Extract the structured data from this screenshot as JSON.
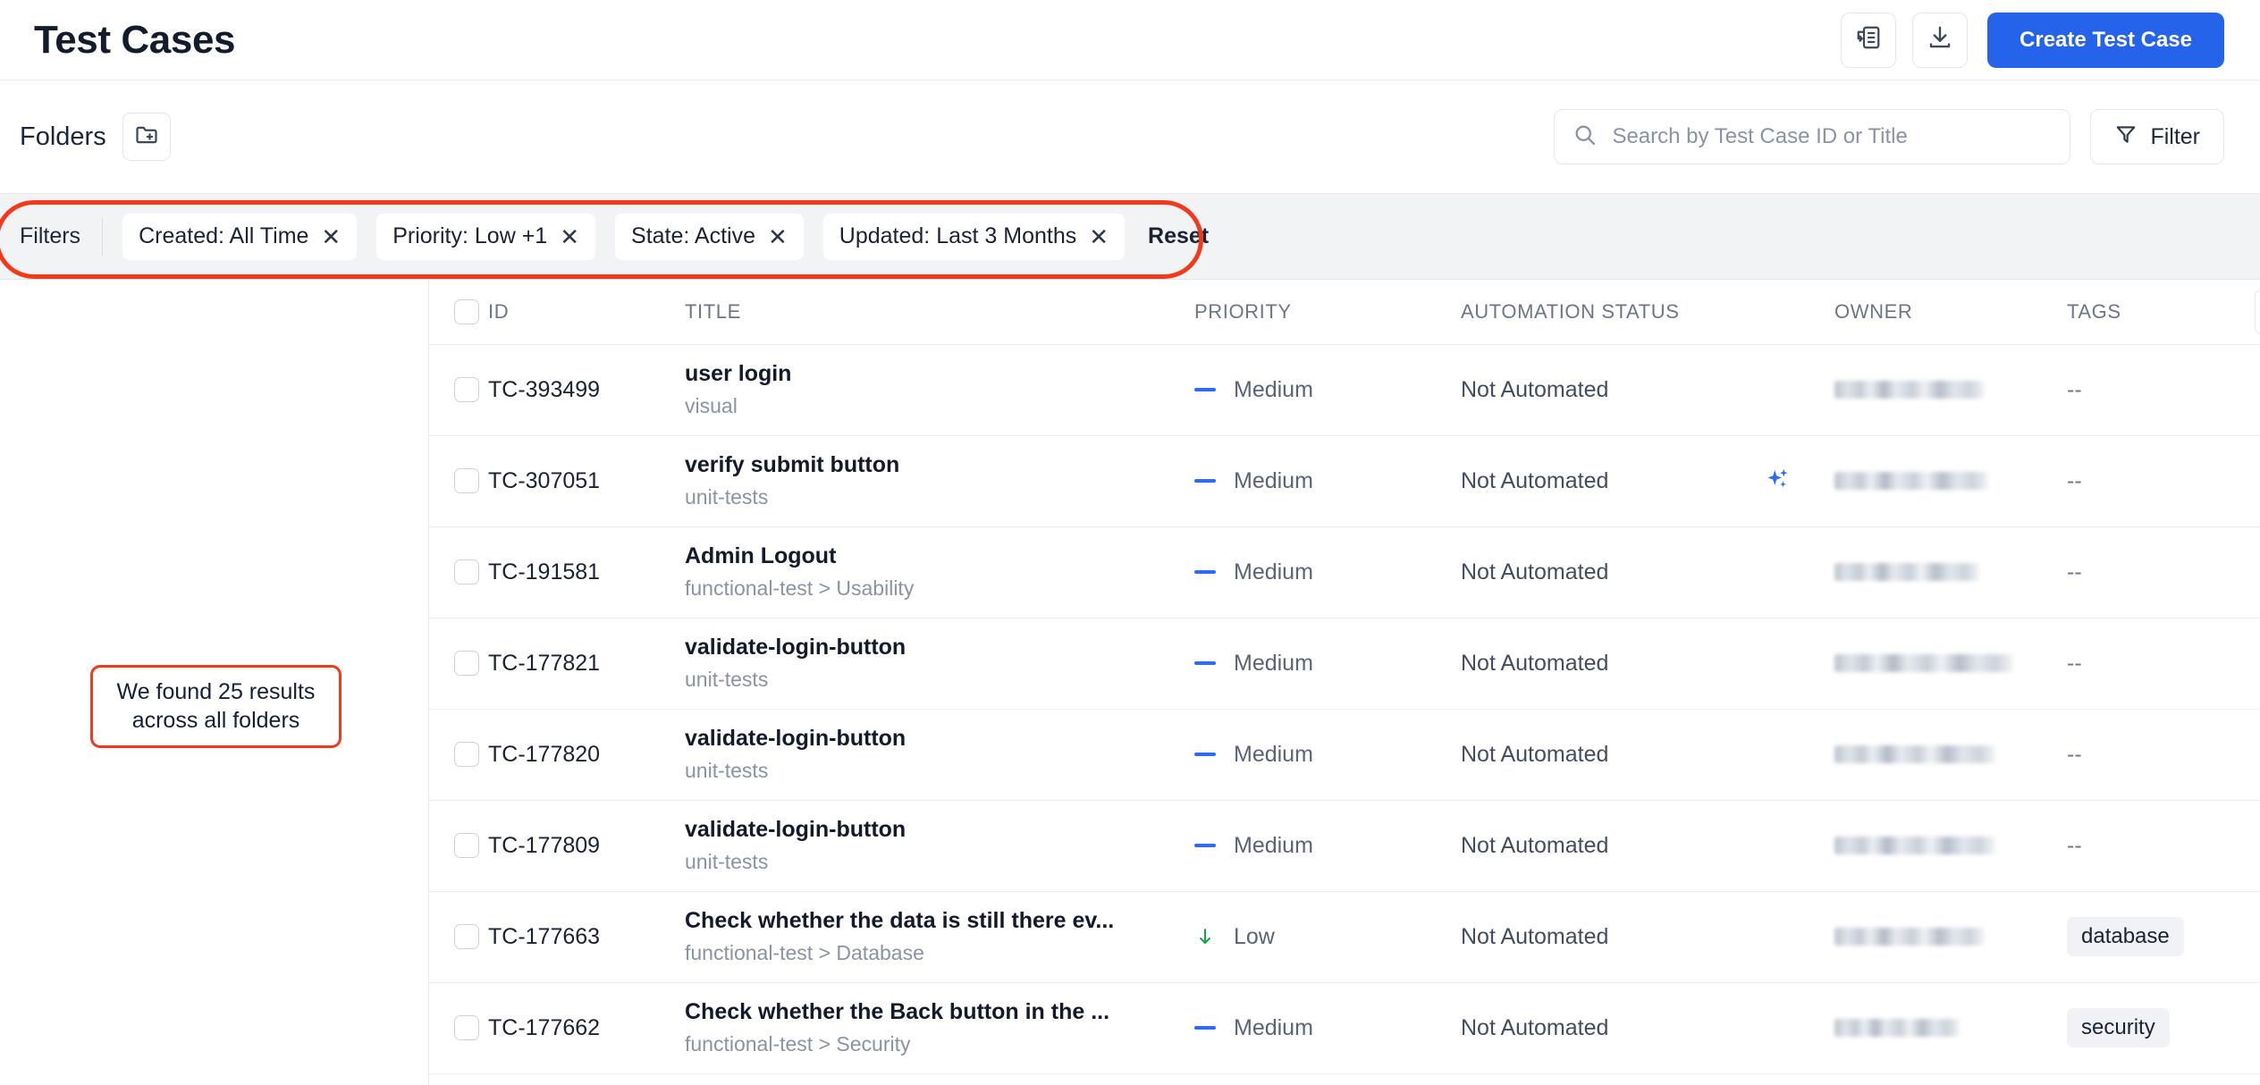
{
  "header": {
    "title": "Test Cases",
    "import_icon": "import-testcase-icon",
    "download_icon": "download-icon",
    "create_button": "Create Test Case",
    "accent_color": "#2563eb"
  },
  "subbar": {
    "folders_label": "Folders",
    "add_folder_icon": "folder-plus-icon",
    "search": {
      "icon": "search-icon",
      "placeholder": "Search by Test Case ID or Title",
      "value": ""
    },
    "filter_button": {
      "icon": "funnel-icon",
      "label": "Filter"
    }
  },
  "filters_bar": {
    "label": "Filters",
    "chips": [
      {
        "label": "Created: All Time",
        "remove_icon": "close-icon"
      },
      {
        "label": "Priority: Low +1",
        "remove_icon": "close-icon"
      },
      {
        "label": "State: Active",
        "remove_icon": "close-icon"
      },
      {
        "label": "Updated: Last 3 Months",
        "remove_icon": "close-icon"
      }
    ],
    "reset_label": "Reset"
  },
  "annotations": {
    "filters_highlight_color": "#f4391b",
    "results_callout": "We found 25 results across all folders"
  },
  "table": {
    "columns": [
      "ID",
      "TITLE",
      "PRIORITY",
      "AUTOMATION STATUS",
      "OWNER",
      "TAGS"
    ],
    "column_config_icon": "column-settings-icon",
    "select_all_checkbox": "unchecked",
    "rows": [
      {
        "id": "TC-393499",
        "title": "user login",
        "path": "visual",
        "priority": "Medium",
        "priority_icon": "priority-medium-icon",
        "automation_status": "Not Automated",
        "ai_icon": "",
        "owner": "",
        "owner_redacted": true,
        "tags": "--",
        "menu_icon": "more-vertical-icon"
      },
      {
        "id": "TC-307051",
        "title": "verify submit button",
        "path": "unit-tests",
        "priority": "Medium",
        "priority_icon": "priority-medium-icon",
        "automation_status": "Not Automated",
        "ai_icon": "ai-sparkle-icon",
        "owner": "",
        "owner_redacted": true,
        "tags": "--",
        "menu_icon": "more-vertical-icon"
      },
      {
        "id": "TC-191581",
        "title": "Admin Logout",
        "path": "functional-test > Usability",
        "priority": "Medium",
        "priority_icon": "priority-medium-icon",
        "automation_status": "Not Automated",
        "ai_icon": "",
        "owner": "",
        "owner_redacted": true,
        "tags": "--",
        "menu_icon": "more-vertical-icon"
      },
      {
        "id": "TC-177821",
        "title": "validate-login-button",
        "path": "unit-tests",
        "priority": "Medium",
        "priority_icon": "priority-medium-icon",
        "automation_status": "Not Automated",
        "ai_icon": "",
        "owner": "",
        "owner_redacted": true,
        "tags": "--",
        "menu_icon": "more-vertical-icon"
      },
      {
        "id": "TC-177820",
        "title": "validate-login-button",
        "path": "unit-tests",
        "priority": "Medium",
        "priority_icon": "priority-medium-icon",
        "automation_status": "Not Automated",
        "ai_icon": "",
        "owner": "",
        "owner_redacted": true,
        "tags": "--",
        "menu_icon": "more-vertical-icon"
      },
      {
        "id": "TC-177809",
        "title": "validate-login-button",
        "path": "unit-tests",
        "priority": "Medium",
        "priority_icon": "priority-medium-icon",
        "automation_status": "Not Automated",
        "ai_icon": "",
        "owner": "",
        "owner_redacted": true,
        "tags": "--",
        "menu_icon": "more-vertical-icon"
      },
      {
        "id": "TC-177663",
        "title": "Check whether the data is still there ev...",
        "path": "functional-test > Database",
        "priority": "Low",
        "priority_icon": "priority-low-icon",
        "automation_status": "Not Automated",
        "ai_icon": "",
        "owner": "",
        "owner_redacted": true,
        "tags": "database",
        "menu_icon": "more-vertical-icon"
      },
      {
        "id": "TC-177662",
        "title": "Check whether the Back button in the ...",
        "path": "functional-test > Security",
        "priority": "Medium",
        "priority_icon": "priority-medium-icon",
        "automation_status": "Not Automated",
        "ai_icon": "",
        "owner": "",
        "owner_redacted": true,
        "tags": "security",
        "menu_icon": "more-vertical-icon"
      }
    ]
  },
  "colors": {
    "priority_medium": "#2f6bf0",
    "priority_low": "#16a34a",
    "ai_sparkle": "#2f6bf0"
  }
}
